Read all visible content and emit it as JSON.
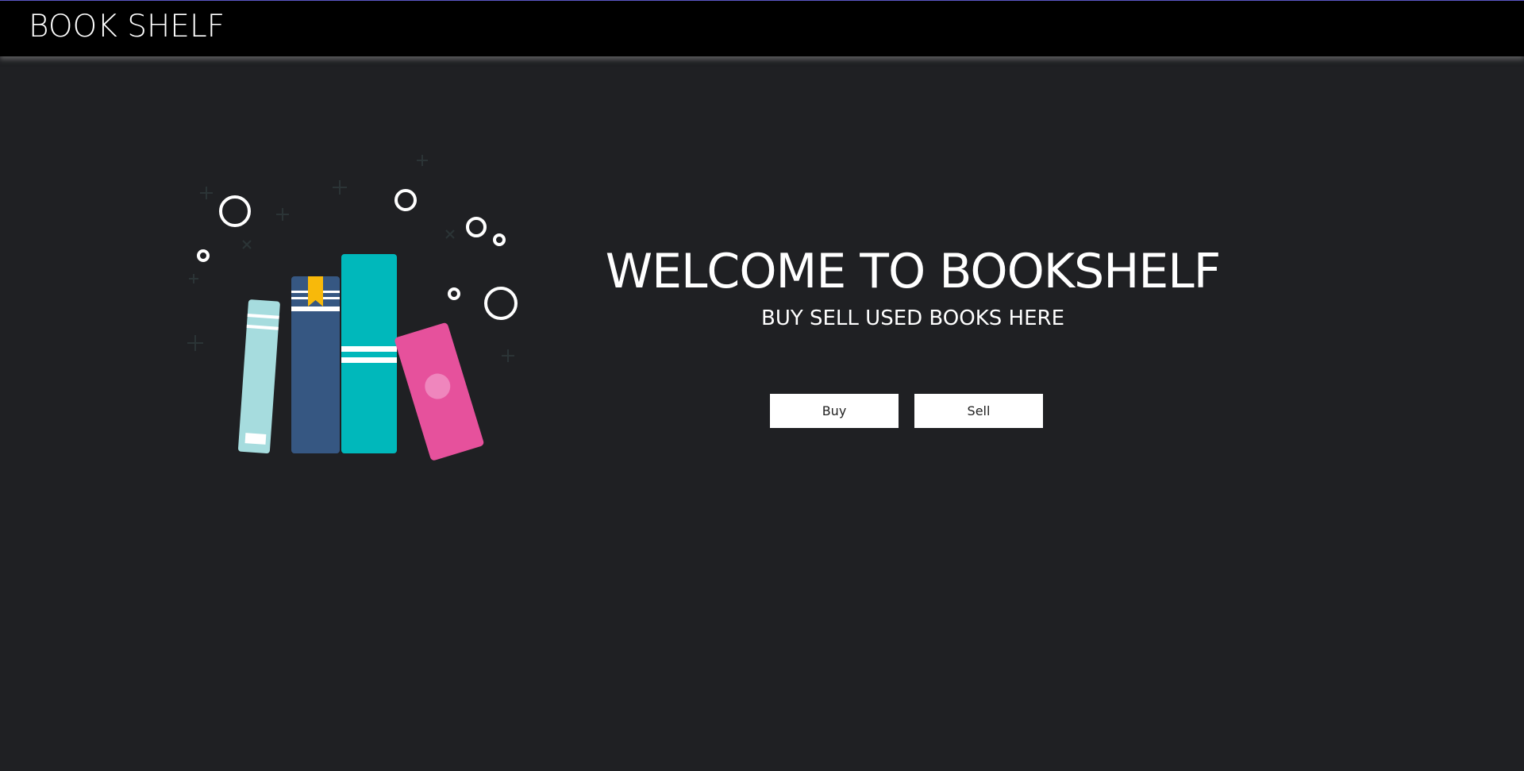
{
  "navbar": {
    "brand": "BOOK SHELF"
  },
  "hero": {
    "title": "WELCOME TO BOOKSHELF",
    "subtitle": "BUY SELL USED BOOKS HERE",
    "illustration": "books-illustration"
  },
  "actions": {
    "buy_label": "Buy",
    "sell_label": "Sell"
  },
  "colors": {
    "background": "#1f2023",
    "navbar": "#000000",
    "book_light_teal": "#a6dcde",
    "book_navy": "#365782",
    "book_teal": "#00b8bb",
    "book_pink": "#e6519c",
    "bookmark_yellow": "#f8b90a"
  }
}
